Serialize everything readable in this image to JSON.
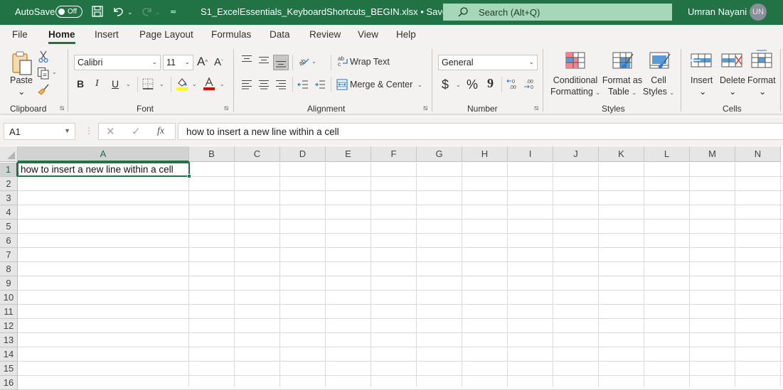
{
  "titlebar": {
    "autosave_label": "AutoSave",
    "autosave_state": "Off",
    "filename": "S1_ExcelEssentials_KeyboardShortcuts_BEGIN.xlsx",
    "save_status": "• Saved",
    "search_placeholder": "Search (Alt+Q)",
    "user_name": "Umran Nayani",
    "user_initials": "UN",
    "brand_color": "#217346"
  },
  "tabs": [
    {
      "label": "File",
      "active": false
    },
    {
      "label": "Home",
      "active": true
    },
    {
      "label": "Insert",
      "active": false
    },
    {
      "label": "Page Layout",
      "active": false
    },
    {
      "label": "Formulas",
      "active": false
    },
    {
      "label": "Data",
      "active": false
    },
    {
      "label": "Review",
      "active": false
    },
    {
      "label": "View",
      "active": false
    },
    {
      "label": "Help",
      "active": false
    }
  ],
  "ribbon": {
    "clipboard": {
      "label": "Clipboard",
      "paste": "Paste"
    },
    "font": {
      "label": "Font",
      "font_name": "Calibri",
      "font_size": "11",
      "bold": "B",
      "italic": "I",
      "underline": "U",
      "fill_color": "#ffff00",
      "font_color": "#e00000"
    },
    "alignment": {
      "label": "Alignment",
      "wrap_text": "Wrap Text",
      "merge_center": "Merge & Center"
    },
    "number": {
      "label": "Number",
      "format": "General",
      "currency": "$",
      "percent": "%",
      "comma": "9"
    },
    "styles": {
      "label": "Styles",
      "conditional": [
        "Conditional",
        "Formatting"
      ],
      "format_table": [
        "Format as",
        "Table"
      ],
      "cell_styles": [
        "Cell",
        "Styles"
      ]
    },
    "cells": {
      "label": "Cells",
      "insert": "Insert",
      "delete": "Delete",
      "format": "Format"
    }
  },
  "formula_bar": {
    "name_box": "A1",
    "fx": "fx",
    "content": "how to insert a new line within a cell"
  },
  "sheet": {
    "columns": [
      "A",
      "B",
      "C",
      "D",
      "E",
      "F",
      "G",
      "H",
      "I",
      "J",
      "K",
      "L",
      "M",
      "N"
    ],
    "rows": [
      "1",
      "2",
      "3",
      "4",
      "5",
      "6",
      "7",
      "8",
      "9",
      "10",
      "11",
      "12",
      "13",
      "14",
      "15",
      "16"
    ],
    "selected_cell": "A1",
    "cells": {
      "A1": "how to insert a new line within a cell"
    }
  }
}
